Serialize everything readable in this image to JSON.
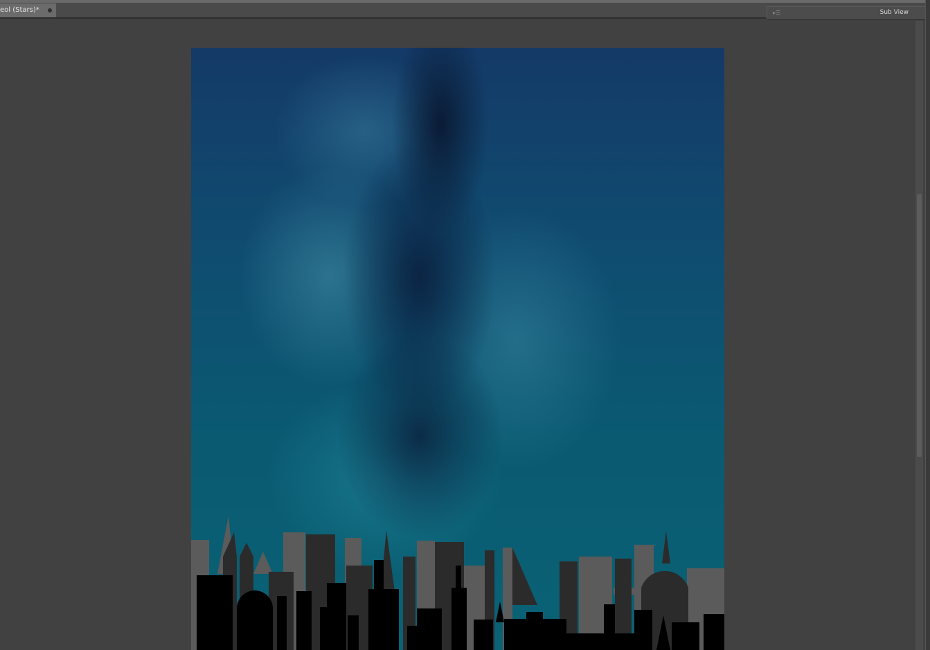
{
  "document_tab": {
    "title": "eol (Stars)*",
    "modified_indicator": "unsaved-dot-icon"
  },
  "sub_view": {
    "label": "Sub View",
    "icon": "panel-menu-icon"
  },
  "artwork": {
    "description_colors": {
      "sky_top": "#143a68",
      "sky_bottom": "#0a6274",
      "skyline_back": "#5b5b5b",
      "skyline_mid": "#2b2b2b",
      "skyline_front": "#000000"
    }
  }
}
